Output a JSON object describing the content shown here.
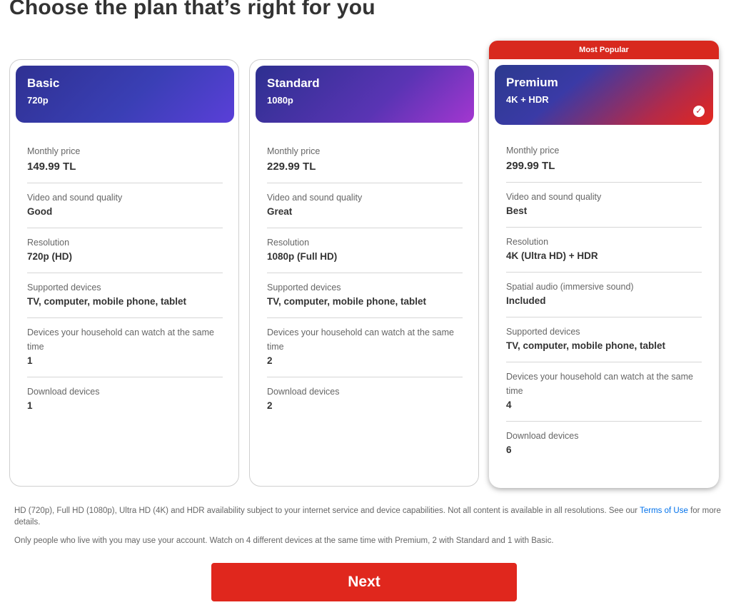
{
  "page": {
    "title": "Choose the plan that’s right for you"
  },
  "plans": [
    {
      "name": "Basic",
      "resolution_tag": "720p",
      "rows": [
        {
          "label": "Monthly price",
          "value": "149.99 TL"
        },
        {
          "label": "Video and sound quality",
          "value": "Good"
        },
        {
          "label": "Resolution",
          "value": "720p (HD)"
        },
        {
          "label": "Supported devices",
          "value": "TV, computer, mobile phone, tablet"
        },
        {
          "label": "Devices your household can watch at the same time",
          "value": "1"
        },
        {
          "label": "Download devices",
          "value": "1"
        }
      ]
    },
    {
      "name": "Standard",
      "resolution_tag": "1080p",
      "rows": [
        {
          "label": "Monthly price",
          "value": "229.99 TL"
        },
        {
          "label": "Video and sound quality",
          "value": "Great"
        },
        {
          "label": "Resolution",
          "value": "1080p (Full HD)"
        },
        {
          "label": "Supported devices",
          "value": "TV, computer, mobile phone, tablet"
        },
        {
          "label": "Devices your household can watch at the same time",
          "value": "2"
        },
        {
          "label": "Download devices",
          "value": "2"
        }
      ]
    },
    {
      "name": "Premium",
      "resolution_tag": "4K + HDR",
      "badge": "Most Popular",
      "selected": true,
      "rows": [
        {
          "label": "Monthly price",
          "value": "299.99 TL"
        },
        {
          "label": "Video and sound quality",
          "value": "Best"
        },
        {
          "label": "Resolution",
          "value": "4K (Ultra HD) + HDR"
        },
        {
          "label": "Spatial audio (immersive sound)",
          "value": "Included"
        },
        {
          "label": "Supported devices",
          "value": "TV, computer, mobile phone, tablet"
        },
        {
          "label": "Devices your household can watch at the same time",
          "value": "4"
        },
        {
          "label": "Download devices",
          "value": "6"
        }
      ]
    }
  ],
  "footer": {
    "note1_before": "HD (720p), Full HD (1080p), Ultra HD (4K) and HDR availability subject to your internet service and device capabilities. Not all content is available in all resolutions. See our ",
    "note1_link": "Terms of Use",
    "note1_after": " for more details.",
    "note2": "Only people who live with you may use your account. Watch on 4 different devices at the same time with Premium, 2 with Standard and 1 with Basic."
  },
  "next_button": {
    "label": "Next"
  },
  "colors": {
    "accent": "#e50914",
    "link": "#0071eb",
    "check": "#ffffff"
  }
}
